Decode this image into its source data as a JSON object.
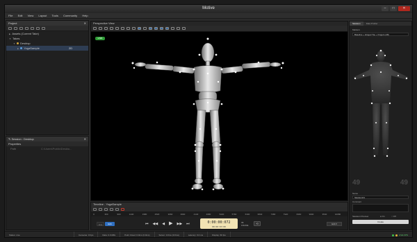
{
  "window": {
    "title": "Motive"
  },
  "menu": [
    "File",
    "Edit",
    "View",
    "Layout",
    "Tools",
    "Community",
    "Help"
  ],
  "project": {
    "header": "Project",
    "items": [
      {
        "label": "Assets (Current Take)",
        "indent": 0
      },
      {
        "label": "Takes",
        "indent": 0
      },
      {
        "label": "Desktop",
        "indent": 1
      },
      {
        "label": "YogaSample",
        "indent": 2,
        "extra": "2D"
      }
    ]
  },
  "session": {
    "header": "Session : Desktop",
    "props_label": "Properties",
    "row_key": "Path",
    "row_value": "C:\\Users\\Public\\Deskto..."
  },
  "viewport": {
    "header": "Perspective View",
    "live_badge": "LIVE"
  },
  "timeline": {
    "header": "Timeline - YogaSample",
    "ticks": [
      "0",
      "360",
      "900",
      "1440",
      "1980",
      "2520",
      "3060",
      "3600",
      "4140",
      "4680",
      "5220",
      "5760",
      "6300",
      "6840",
      "7380",
      "7920",
      "8460",
      "9000",
      "9540",
      "10080"
    ],
    "mode_live": "Live",
    "mode_edit": "Edit",
    "timecode": "0:00:00:072",
    "timecode_sub": "00:00:03:00",
    "frame_label": "FRAME",
    "frame_value": "72",
    "edit_menu": "Edit ▾"
  },
  "right_panel": {
    "tabs": [
      "Skeleton",
      "Data Profiler"
    ],
    "section": "Markers",
    "template": "Baseline + Hinged Toe + Fingers (48)",
    "big_left": "49",
    "big_right": "49",
    "name_label": "Name",
    "name_value": "Skeleton01",
    "comment_label": "Comment",
    "preview_label": "Skeleton Preview",
    "opt_on": "On",
    "opt_off": "Off",
    "create_label": "Create"
  },
  "status": {
    "left": "Status: Live",
    "cameras": "Cameras: 0 Fps",
    "data": "Data: 0.0 kB/s",
    "pointcloud": "Point Cloud: 0.0ms (0.0ms)",
    "solver": "Solver: 0.0ms (0.0ms)",
    "latency": "Latency: 0.0 ms",
    "display": "Display: 60 fps",
    "indicator": "LIVE  FPS"
  }
}
